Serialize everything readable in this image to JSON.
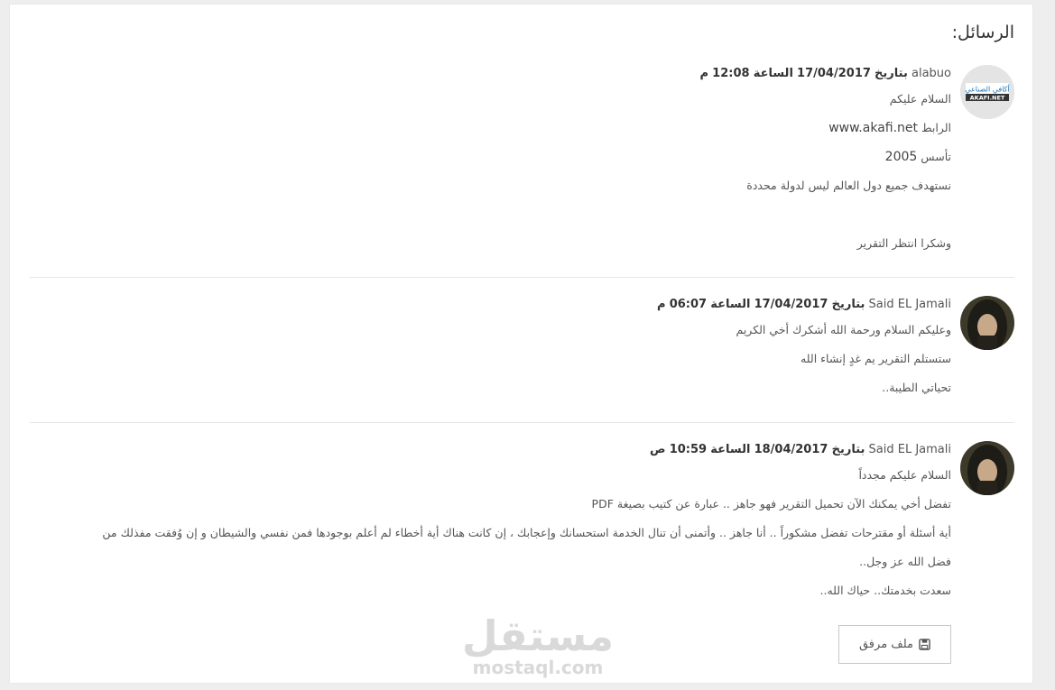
{
  "section_title": "الرسائل:",
  "messages": [
    {
      "user": "alabuo",
      "date_label": "بتاريخ",
      "date": "17/04/2017",
      "time_label": "الساعة",
      "time": "12:08",
      "ampm": "م",
      "lines": [
        "السلام عليكم",
        "الرابط",
        "www.akafi.net",
        "تأسس",
        "2005",
        "نستهدف جميع دول العالم ليس لدولة محددة",
        "وشكرا انتظر التقرير"
      ],
      "avatar_text_top": "أكافي الصناعي",
      "avatar_text_bottom": "AKAFI.NET"
    },
    {
      "user": "Said EL Jamali",
      "date_label": "بتاريخ",
      "date": "17/04/2017",
      "time_label": "الساعة",
      "time": "06:07",
      "ampm": "م",
      "lines": [
        "وعليكم السلام ورحمة الله أشكرك أخي الكريم",
        "ستستلم التقرير يم غدٍ إنشاء الله",
        "تحياتي الطيبة.."
      ]
    },
    {
      "user": "Said EL Jamali",
      "date_label": "بتاريخ",
      "date": "18/04/2017",
      "time_label": "الساعة",
      "time": "10:59",
      "ampm": "ص",
      "lines": [
        "السلام عليكم مجدداً",
        "تفضل أخي يمكنك الآن تحميل التقرير فهو جاهز .. عبارة عن كتيب بصيغة PDF",
        "أية أسئلة أو مقترحات تفضل مشكوراً .. أنا جاهز .. وأتمنى أن تنال الخدمة استحسانك وإعجابك ، إن كانت هناك أية أخطاء لم أعلم بوجودها فمن نفسي والشيطان و إن وُفقت مفذلك من",
        "فضل الله عز وجل..",
        "سعدت بخدمتك.. حياك الله.."
      ]
    }
  ],
  "attachment_label": "ملف مرفق",
  "watermark": {
    "arabic": "مستقل",
    "latin": "mostaql.com"
  },
  "colors": {
    "page_bg": "#eeeeee",
    "panel_bg": "#ffffff",
    "text": "#444444",
    "separator": "#e6e6e6"
  }
}
